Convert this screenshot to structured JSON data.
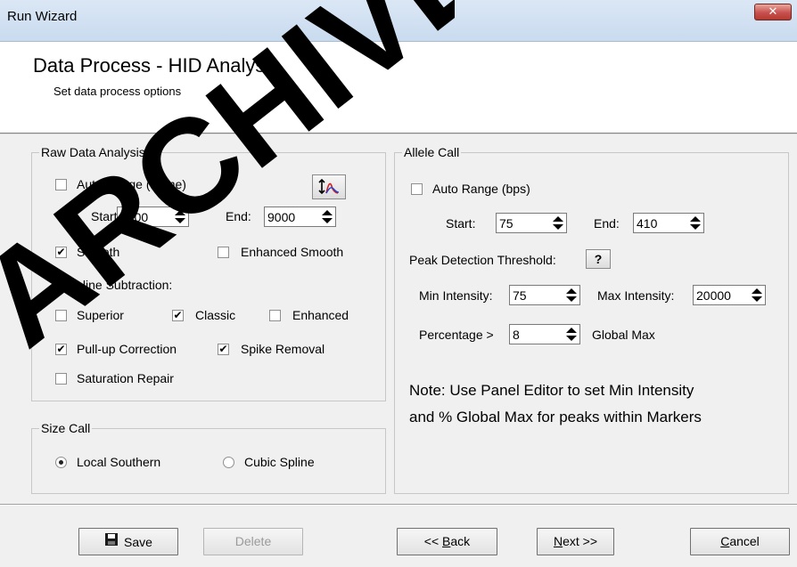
{
  "window": {
    "title": "Run Wizard",
    "close_glyph": "✕"
  },
  "header": {
    "title": "Data Process - HID Analysis",
    "subtitle": "Set data process options"
  },
  "raw": {
    "legend": "Raw Data Analysis",
    "auto_range": "Auto Range (frame)",
    "start_label": "Start:",
    "start_value": "2300",
    "end_label": "End:",
    "end_value": "9000",
    "smooth": "Smooth",
    "enhanced_smooth": "Enhanced Smooth",
    "baseline_label": "Baseline Subtraction:",
    "superior": "Superior",
    "classic": "Classic",
    "enhanced": "Enhanced",
    "pullup": "Pull-up Correction",
    "spike": "Spike Removal",
    "saturation": "Saturation Repair"
  },
  "size": {
    "legend": "Size Call",
    "local_southern": "Local Southern",
    "cubic_spline": "Cubic Spline"
  },
  "allele": {
    "legend": "Allele Call",
    "auto_range": "Auto Range (bps)",
    "start_label": "Start:",
    "start_value": "75",
    "end_label": "End:",
    "end_value": "410",
    "peak_threshold": "Peak Detection Threshold:",
    "help_glyph": "?",
    "min_label": "Min Intensity:",
    "min_value": "75",
    "max_label": "Max Intensity:",
    "max_value": "20000",
    "percent_label": "Percentage >",
    "percent_value": "8",
    "global_max": "Global Max",
    "note_line1": "Note: Use Panel Editor to set Min Intensity",
    "note_line2": "and % Global Max for peaks within Markers"
  },
  "footer": {
    "save": "Save",
    "delete": "Delete",
    "back_prefix": "<< ",
    "back_key": "B",
    "back_rest": "ack",
    "next_key": "N",
    "next_rest": "ext >>",
    "cancel_key": "C",
    "cancel_rest": "ancel"
  },
  "watermark_text": "ARCHIVED"
}
